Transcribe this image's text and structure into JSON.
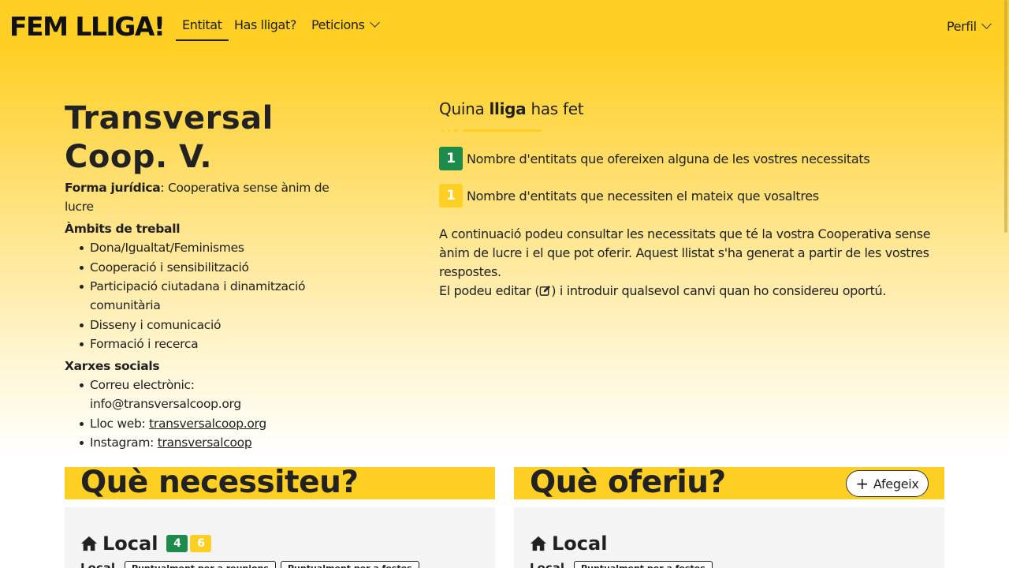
{
  "nav": {
    "brand": "FEM LLIGA!",
    "items": [
      {
        "label": "Entitat"
      },
      {
        "label": "Has lligat?"
      },
      {
        "label": "Peticions"
      }
    ],
    "profile": "Perfil"
  },
  "entity": {
    "name": "Transversal Coop. V.",
    "legal_form_label": "Forma jurídica",
    "legal_form": ": Cooperativa sense ànim de lucre",
    "areas_label": "Àmbits de treball",
    "areas": [
      "Dona/Igualtat/Feminismes",
      "Cooperació i sensibilització",
      "Participació ciutadana i dinamització comunitària",
      "Disseny i comunicació",
      "Formació i recerca"
    ],
    "social_label": "Xarxes socials",
    "social": {
      "email_label": "Correu electrònic:",
      "email": "info@transversalcoop.org",
      "web_label": "Lloc web:",
      "web": "transversalcoop.org",
      "instagram_label": "Instagram:",
      "instagram": "transversalcoop"
    }
  },
  "lliga": {
    "title_pre": "Quina",
    "title_bold": "lliga",
    "title_post": "has fet",
    "offer_count": "1",
    "offer_text": "Nombre d'entitats que ofereixen alguna de les vostres necessitats",
    "need_count": "1",
    "need_text": "Nombre d'entitats que necessiten el mateix que vosaltres",
    "para1": "A continuació podeu consultar les necessitats que té la vostra Cooperativa sense ànim de lucre i el que pot oferir. Aquest llistat s'ha generat a partir de les vostres respostes.",
    "para2_pre": "El podeu editar (",
    "para2_post": ") i introduir qualsevol canvi quan ho considereu oportú."
  },
  "needs_panel": {
    "title": "Què necessiteu?",
    "local_label": "Local",
    "badge_green": "4",
    "badge_yellow": "6",
    "tag_label": "Local",
    "tags": [
      "Puntualment per a reunions",
      "Puntualment per a festes"
    ]
  },
  "offers_panel": {
    "title": "Què oferiu?",
    "add_label": "Afegeix",
    "local_label": "Local",
    "tag_label": "Local",
    "tags": [
      "Puntualment per a festes"
    ]
  },
  "colors": {
    "brand_yellow": "#ffcf23",
    "green": "#1e8a4c",
    "yellow_badge": "#ffcf23"
  }
}
